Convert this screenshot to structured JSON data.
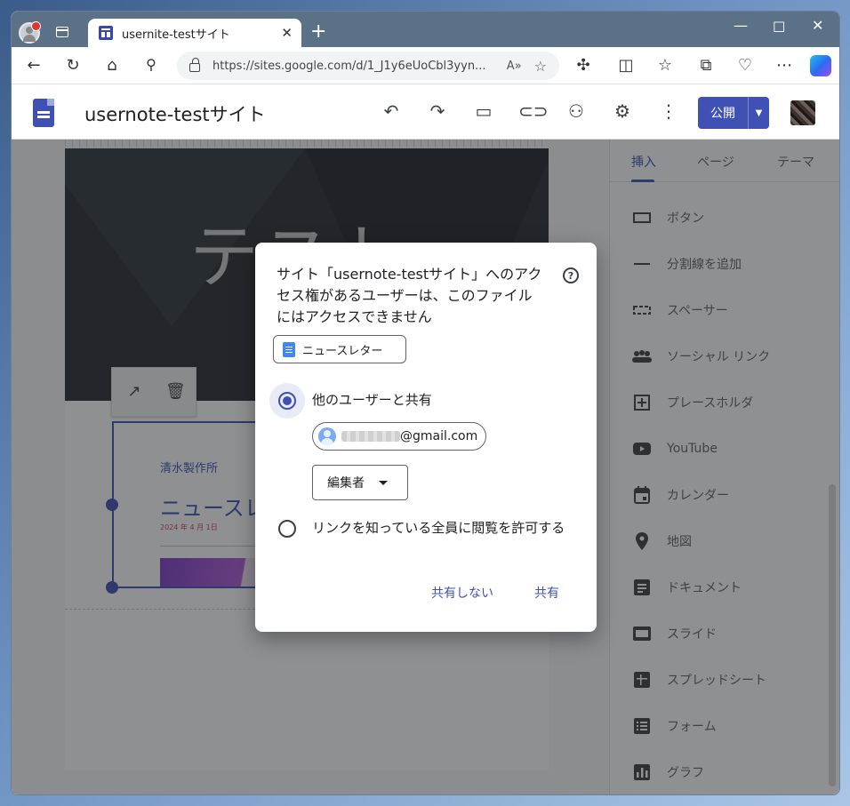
{
  "browser": {
    "tab_title": "usernite-testサイト",
    "url": "https://sites.google.com/d/1_J1y6eUoCbl3yyn..."
  },
  "app": {
    "site_title": "usernote-testサイト",
    "publish_label": "公開"
  },
  "page": {
    "hero_text": "テスト",
    "company": "清水製作所",
    "news_heading": "ニュースレ",
    "date": "2024 年 4 月 1日"
  },
  "panel": {
    "tabs": [
      "挿入",
      "ページ",
      "テーマ"
    ],
    "items": [
      {
        "label": "ボタン",
        "icon": "button-icon"
      },
      {
        "label": "分割線を追加",
        "icon": "divider-icon"
      },
      {
        "label": "スペーサー",
        "icon": "spacer-icon"
      },
      {
        "label": "ソーシャル リンク",
        "icon": "people-icon"
      },
      {
        "label": "プレースホルダ",
        "icon": "placeholder-icon"
      },
      {
        "label": "YouTube",
        "icon": "youtube-icon"
      },
      {
        "label": "カレンダー",
        "icon": "calendar-icon"
      },
      {
        "label": "地図",
        "icon": "map-pin-icon"
      },
      {
        "label": "ドキュメント",
        "icon": "document-icon"
      },
      {
        "label": "スライド",
        "icon": "slides-icon"
      },
      {
        "label": "スプレッドシート",
        "icon": "sheets-icon"
      },
      {
        "label": "フォーム",
        "icon": "forms-icon"
      },
      {
        "label": "グラフ",
        "icon": "chart-icon"
      }
    ]
  },
  "dialog": {
    "title": "サイト「usernote-testサイト」へのアクセス権があるユーザーは、このファイルにはアクセスできません",
    "file_chip": "ニュースレター",
    "option_share": "他のユーザーと共有",
    "email_suffix": "@gmail.com",
    "role": "編集者",
    "option_link": "リンクを知っている全員に閲覧を許可する",
    "btn_dont_share": "共有しない",
    "btn_share": "共有"
  },
  "colors": {
    "accent": "#3f51b5",
    "hero_bg": "#262d33"
  }
}
